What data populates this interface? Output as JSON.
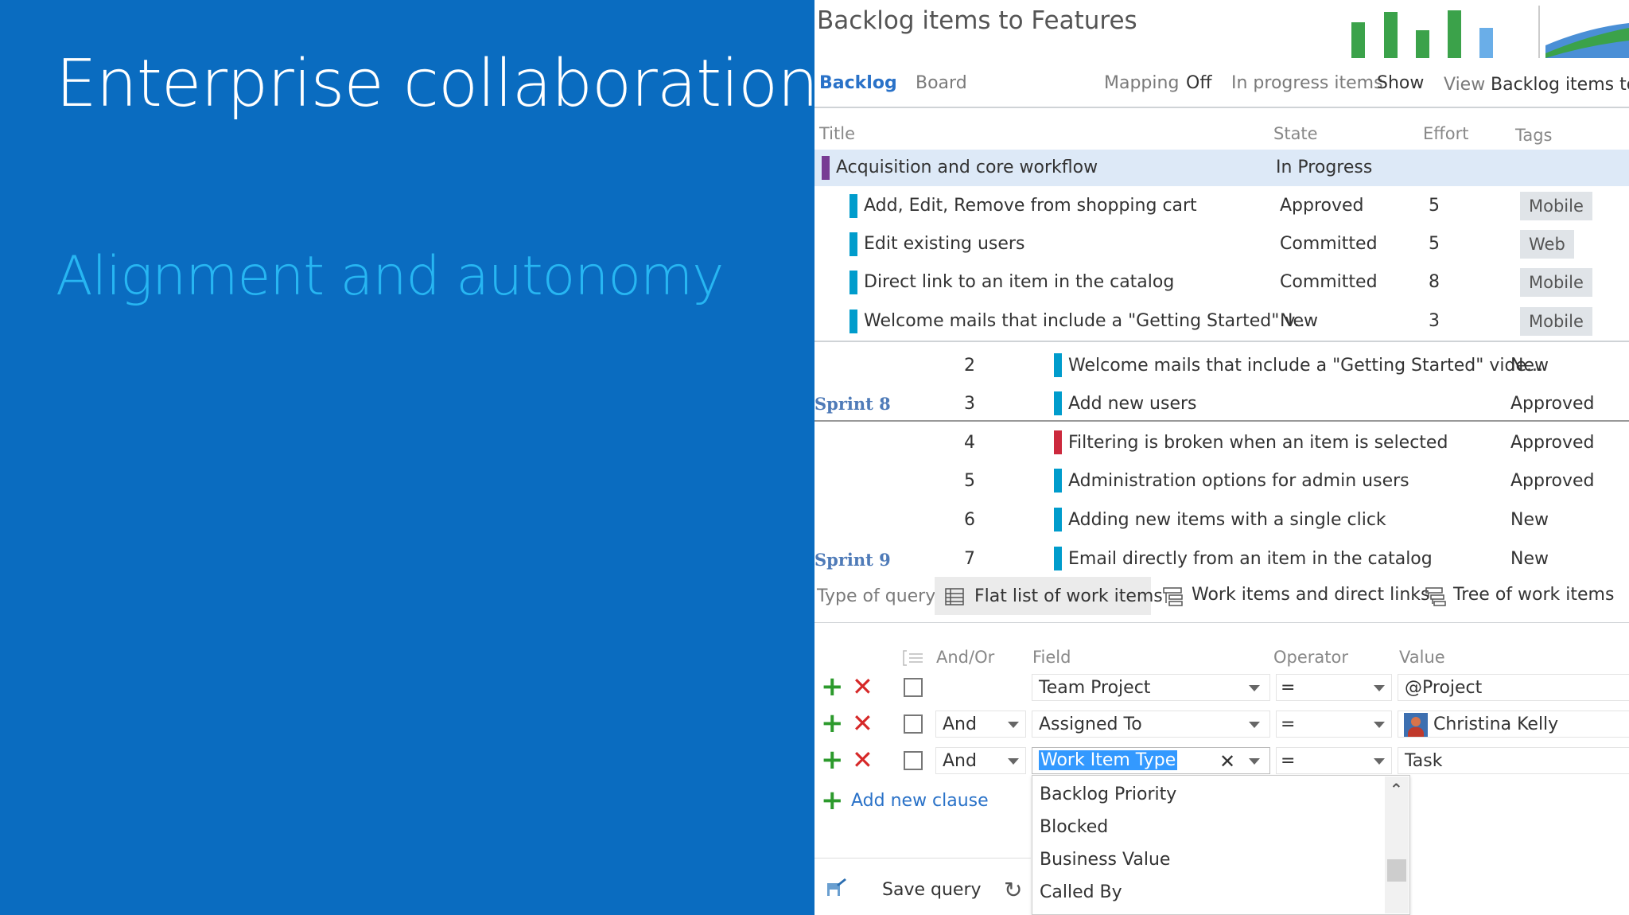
{
  "slide": {
    "title": "Enterprise collaboration",
    "subtitle": "Alignment and autonomy"
  },
  "backlog_panel": {
    "title": "Backlog items to Features",
    "tabs": {
      "backlog": "Backlog",
      "board": "Board"
    },
    "mapping_label": "Mapping",
    "mapping_value": "Off",
    "inprogress_label": "In progress items",
    "inprogress_value": "Show",
    "view_label": "View",
    "view_value": "Backlog items to l",
    "columns": {
      "title": "Title",
      "state": "State",
      "effort": "Effort",
      "tags": "Tags"
    },
    "feature": {
      "title": "Acquisition and core workflow",
      "state": "In Progress",
      "color": "#773b93"
    },
    "rows": [
      {
        "title": "Add, Edit, Remove from shopping cart",
        "state": "Approved",
        "effort": "5",
        "tag": "Mobile"
      },
      {
        "title": "Edit existing users",
        "state": "Committed",
        "effort": "5",
        "tag": "Web"
      },
      {
        "title": "Direct link to an item in the catalog",
        "state": "Committed",
        "effort": "8",
        "tag": "Mobile"
      },
      {
        "title": "Welcome mails that include a \"Getting Started\" v...",
        "state": "New",
        "effort": "3",
        "tag": "Mobile"
      }
    ]
  },
  "sprint_panel": {
    "sprint8": "Sprint 8",
    "sprint9": "Sprint 9",
    "rows": [
      {
        "num": "2",
        "title": "Welcome mails that include a \"Getting Started\" vide...",
        "state": "New",
        "color": "#009ccc"
      },
      {
        "num": "3",
        "title": "Add new users",
        "state": "Approved",
        "color": "#009ccc"
      },
      {
        "num": "4",
        "title": "Filtering is broken when an item is selected",
        "state": "Approved",
        "color": "#cc293d"
      },
      {
        "num": "5",
        "title": "Administration options for admin users",
        "state": "Approved",
        "color": "#009ccc"
      },
      {
        "num": "6",
        "title": "Adding new items with a single click",
        "state": "New",
        "color": "#009ccc"
      },
      {
        "num": "7",
        "title": "Email directly from an item in the catalog",
        "state": "New",
        "color": "#009ccc"
      }
    ]
  },
  "query": {
    "type_label": "Type of query",
    "types": [
      "Flat list of work items",
      "Work items and direct links",
      "Tree of work items"
    ],
    "columns": {
      "andor": "And/Or",
      "field": "Field",
      "operator": "Operator",
      "value": "Value"
    },
    "clauses": [
      {
        "andor": "",
        "field": "Team Project",
        "operator": "=",
        "value": "@Project"
      },
      {
        "andor": "And",
        "field": "Assigned To",
        "operator": "=",
        "value": "Christina Kelly"
      },
      {
        "andor": "And",
        "field": "Work Item Type",
        "operator": "=",
        "value": "Task"
      }
    ],
    "add_clause": "Add new clause",
    "field_options": [
      "Backlog Priority",
      "Blocked",
      "Business Value",
      "Called By"
    ],
    "save_query": "Save query"
  },
  "colors": {
    "slide_bg": "#0a6cc0",
    "subtitle": "#27b6f2",
    "story": "#009ccc",
    "bug": "#cc293d",
    "selected_row": "#dde9f7",
    "link": "#2a72c8"
  }
}
